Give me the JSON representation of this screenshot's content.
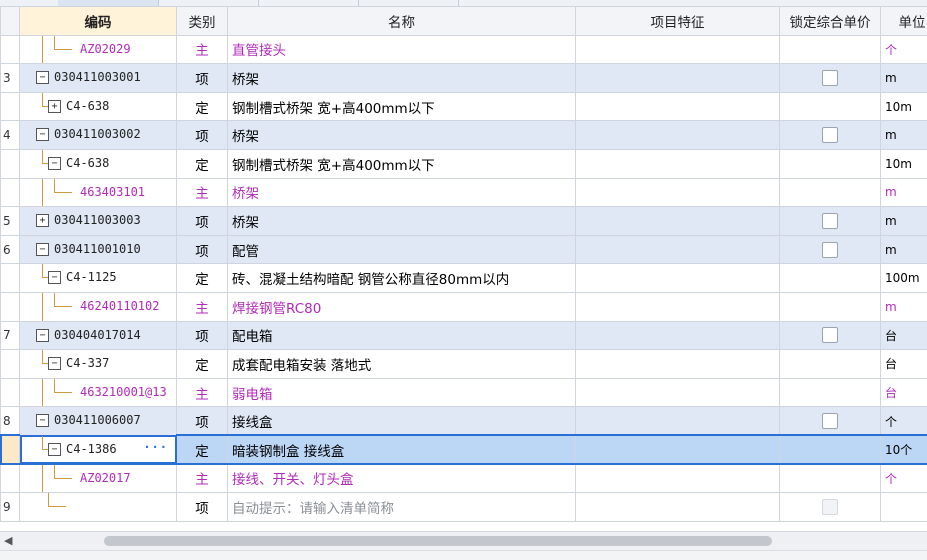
{
  "header": {
    "code": "编码",
    "type": "类别",
    "name": "名称",
    "features": "项目特征",
    "lock_price": "锁定综合单价",
    "unit": "单位"
  },
  "rows": [
    {
      "num": "",
      "code": "AZ02029",
      "type": "主",
      "name": "直管接头",
      "unit": "个",
      "kind": "zhu",
      "checkbox": false
    },
    {
      "num": "3",
      "code": "030411003001",
      "type": "项",
      "name": "桥架",
      "unit": "m",
      "kind": "xiang",
      "checkbox": true
    },
    {
      "num": "",
      "code": "C4-638",
      "type": "定",
      "name": "钢制槽式桥架 宽+高400mm以下",
      "unit": "10m",
      "kind": "ding",
      "checkbox": false
    },
    {
      "num": "4",
      "code": "030411003002",
      "type": "项",
      "name": "桥架",
      "unit": "m",
      "kind": "xiang",
      "checkbox": true
    },
    {
      "num": "",
      "code": "C4-638",
      "type": "定",
      "name": "钢制槽式桥架 宽+高400mm以下",
      "unit": "10m",
      "kind": "ding",
      "checkbox": false
    },
    {
      "num": "",
      "code": "463403101",
      "type": "主",
      "name": "桥架",
      "unit": "m",
      "kind": "zhu",
      "checkbox": false
    },
    {
      "num": "5",
      "code": "030411003003",
      "type": "项",
      "name": "桥架",
      "unit": "m",
      "kind": "xiang",
      "checkbox": true
    },
    {
      "num": "6",
      "code": "030411001010",
      "type": "项",
      "name": "配管",
      "unit": "m",
      "kind": "xiang",
      "checkbox": true
    },
    {
      "num": "",
      "code": "C4-1125",
      "type": "定",
      "name": "砖、混凝土结构暗配 钢管公称直径80mm以内",
      "unit": "100m",
      "kind": "ding",
      "checkbox": false
    },
    {
      "num": "",
      "code": "46240110102",
      "type": "主",
      "name": "焊接钢管RC80",
      "unit": "m",
      "kind": "zhu",
      "checkbox": false
    },
    {
      "num": "7",
      "code": "030404017014",
      "type": "项",
      "name": "配电箱",
      "unit": "台",
      "kind": "xiang",
      "checkbox": true
    },
    {
      "num": "",
      "code": "C4-337",
      "type": "定",
      "name": "成套配电箱安装 落地式",
      "unit": "台",
      "kind": "ding",
      "checkbox": false
    },
    {
      "num": "",
      "code": "463210001@13",
      "type": "主",
      "name": "弱电箱",
      "unit": "台",
      "kind": "zhu",
      "checkbox": false
    },
    {
      "num": "8",
      "code": "030411006007",
      "type": "项",
      "name": "接线盒",
      "unit": "个",
      "kind": "xiang",
      "checkbox": true
    },
    {
      "num": "",
      "code": "C4-1386",
      "type": "定",
      "name": "暗装钢制盒 接线盒",
      "unit": "10个",
      "kind": "sel",
      "checkbox": false
    },
    {
      "num": "",
      "code": "AZ02017",
      "type": "主",
      "name": "接线、开关、灯头盒",
      "unit": "个",
      "kind": "zhu",
      "checkbox": false
    },
    {
      "num": "9",
      "code": "",
      "type": "项",
      "name": "自动提示：请输入清单简称",
      "unit": "",
      "kind": "hint",
      "checkbox": true
    }
  ],
  "colors": {
    "accent": "#2a6fd6",
    "main_material": "#b02bb8",
    "item_row": "#dfe8f4",
    "selected_row": "#bcd6f6",
    "tree_line": "#d09a43"
  },
  "icons": {
    "expand": "plus-box-icon",
    "collapse": "minus-box-icon",
    "more": "ellipsis-icon"
  }
}
